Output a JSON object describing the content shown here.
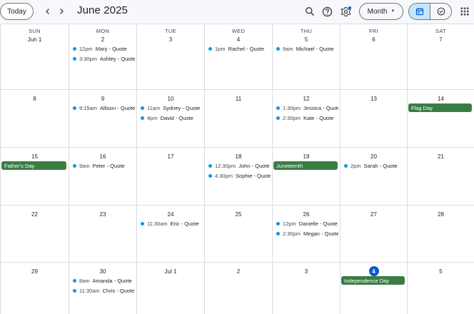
{
  "header": {
    "today_label": "Today",
    "prev_icon": "chevron-left-icon",
    "next_icon": "chevron-right-icon",
    "month_title": "June 2025",
    "search_icon": "search-icon",
    "help_icon": "help-icon",
    "settings_icon": "gear-icon",
    "view_label": "Month",
    "calendar_view_icon": "calendar-icon",
    "tasks_view_icon": "task-check-icon",
    "apps_icon": "apps-grid-icon"
  },
  "colors": {
    "event_dot": "#039be5",
    "allday_bg": "#3a7d44",
    "today_circle": "#0b57d0",
    "active_toggle": "#c2e7ff"
  },
  "weekdays": [
    "SUN",
    "MON",
    "TUE",
    "WED",
    "THU",
    "FRI",
    "SAT"
  ],
  "weeks": [
    [
      {
        "day": "Jun 1",
        "events": []
      },
      {
        "day": "2",
        "events": [
          {
            "time": "12pm",
            "title": "Mary - Quote"
          },
          {
            "time": "3:30pm",
            "title": "Ashley - Quote"
          }
        ]
      },
      {
        "day": "3",
        "events": []
      },
      {
        "day": "4",
        "events": [
          {
            "time": "1pm",
            "title": "Rachel - Quote"
          }
        ]
      },
      {
        "day": "5",
        "events": [
          {
            "time": "9am",
            "title": "Michael - Quote"
          }
        ]
      },
      {
        "day": "6",
        "events": []
      },
      {
        "day": "7",
        "events": []
      }
    ],
    [
      {
        "day": "8",
        "events": []
      },
      {
        "day": "9",
        "events": [
          {
            "time": "9:15am",
            "title": "Allison - Quote"
          }
        ]
      },
      {
        "day": "10",
        "events": [
          {
            "time": "11am",
            "title": "Sydney - Quote"
          },
          {
            "time": "4pm",
            "title": "David - Quote"
          }
        ]
      },
      {
        "day": "11",
        "events": []
      },
      {
        "day": "12",
        "events": [
          {
            "time": "1:30pm",
            "title": "Jessica - Quote"
          },
          {
            "time": "2:30pm",
            "title": "Kate - Quote"
          }
        ]
      },
      {
        "day": "13",
        "events": []
      },
      {
        "day": "14",
        "allday": "Flag Day",
        "events": []
      }
    ],
    [
      {
        "day": "15",
        "allday": "Father's Day",
        "events": []
      },
      {
        "day": "16",
        "events": [
          {
            "time": "9am",
            "title": "Peter - Quote"
          }
        ]
      },
      {
        "day": "17",
        "events": []
      },
      {
        "day": "18",
        "events": [
          {
            "time": "12:30pm",
            "title": "John - Quote"
          },
          {
            "time": "4:30pm",
            "title": "Sophie - Quote"
          }
        ]
      },
      {
        "day": "19",
        "allday": "Juneteenth",
        "events": []
      },
      {
        "day": "20",
        "events": [
          {
            "time": "2pm",
            "title": "Sarah - Quote"
          }
        ]
      },
      {
        "day": "21",
        "events": []
      }
    ],
    [
      {
        "day": "22",
        "events": []
      },
      {
        "day": "23",
        "events": []
      },
      {
        "day": "24",
        "events": [
          {
            "time": "11:30am",
            "title": "Eric - Quote"
          }
        ]
      },
      {
        "day": "25",
        "events": []
      },
      {
        "day": "26",
        "events": [
          {
            "time": "12pm",
            "title": "Danielle - Quote"
          },
          {
            "time": "2:30pm",
            "title": "Megan - Quote"
          }
        ]
      },
      {
        "day": "27",
        "events": []
      },
      {
        "day": "28",
        "events": []
      }
    ],
    [
      {
        "day": "29",
        "events": []
      },
      {
        "day": "30",
        "events": [
          {
            "time": "8am",
            "title": "Amanda - Quote"
          },
          {
            "time": "11:30am",
            "title": "Chris - Quote"
          }
        ]
      },
      {
        "day": "Jul 1",
        "events": []
      },
      {
        "day": "2",
        "events": []
      },
      {
        "day": "3",
        "events": []
      },
      {
        "day": "4",
        "today": true,
        "allday": "Independence Day",
        "events": []
      },
      {
        "day": "5",
        "events": []
      }
    ]
  ]
}
